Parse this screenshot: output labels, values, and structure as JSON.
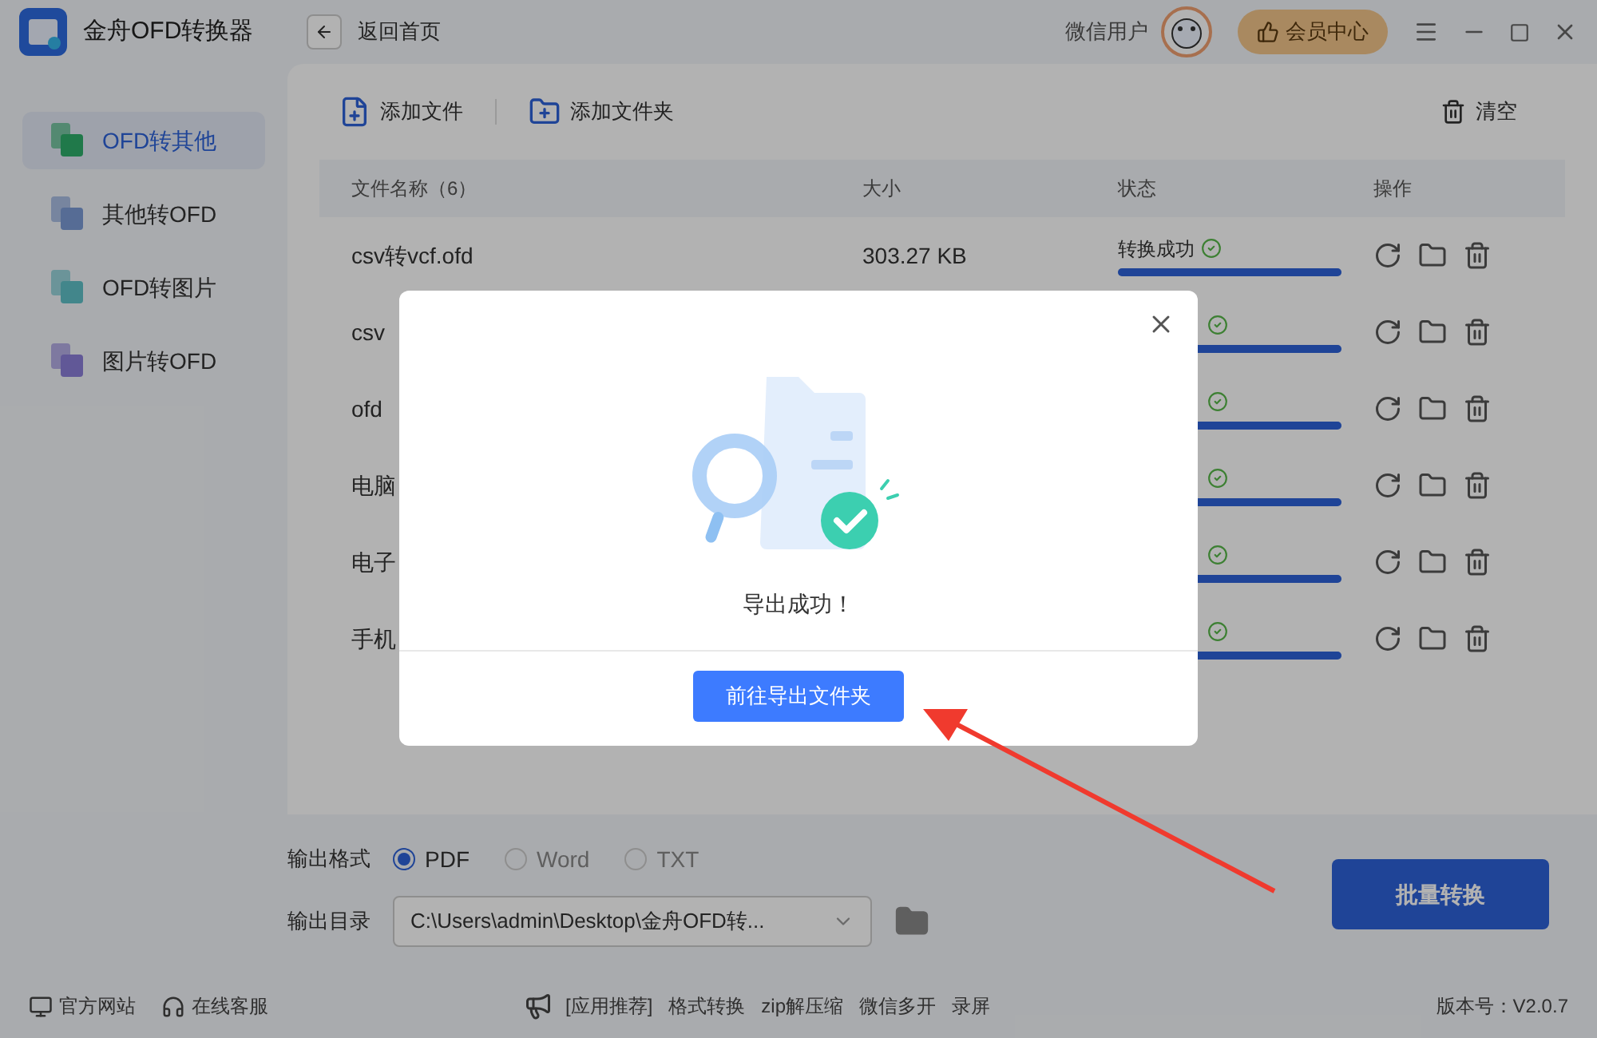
{
  "app": {
    "title": "金舟OFD转换器",
    "back": "返回首页",
    "user": "微信用户",
    "vip": "会员中心"
  },
  "sidebar": {
    "items": [
      {
        "label": "OFD转其他",
        "selected": true
      },
      {
        "label": "其他转OFD",
        "selected": false
      },
      {
        "label": "OFD转图片",
        "selected": false
      },
      {
        "label": "图片转OFD",
        "selected": false
      }
    ]
  },
  "toolbar": {
    "add_file": "添加文件",
    "add_folder": "添加文件夹",
    "clear": "清空"
  },
  "table": {
    "columns": [
      "文件名称（6）",
      "大小",
      "状态",
      "操作"
    ],
    "rows": [
      {
        "name": "csv转vcf.ofd",
        "size": "303.27 KB",
        "status": "转换成功",
        "level": 1
      },
      {
        "name": "csv",
        "level": 1
      },
      {
        "name": "ofd",
        "level": 1
      },
      {
        "name": "电脑",
        "level": 1
      },
      {
        "name": "电子",
        "level": 1
      },
      {
        "name": "手机",
        "level": 1
      }
    ]
  },
  "output": {
    "format_label": "输出格式",
    "formats": [
      {
        "label": "PDF",
        "selected": true
      },
      {
        "label": "Word",
        "selected": false
      },
      {
        "label": "TXT",
        "selected": false
      }
    ],
    "dir_label": "输出目录",
    "dir_value": "C:\\Users\\admin\\Desktop\\金舟OFD转...",
    "convert": "批量转换"
  },
  "footer": {
    "site": "官方网站",
    "service": "在线客服",
    "recommend": "[应用推荐]",
    "links": [
      "格式转换",
      "zip解压缩",
      "微信多开",
      "录屏"
    ],
    "version": "版本号：V2.0.7"
  },
  "dialog": {
    "message": "导出成功！",
    "button": "前往导出文件夹"
  }
}
